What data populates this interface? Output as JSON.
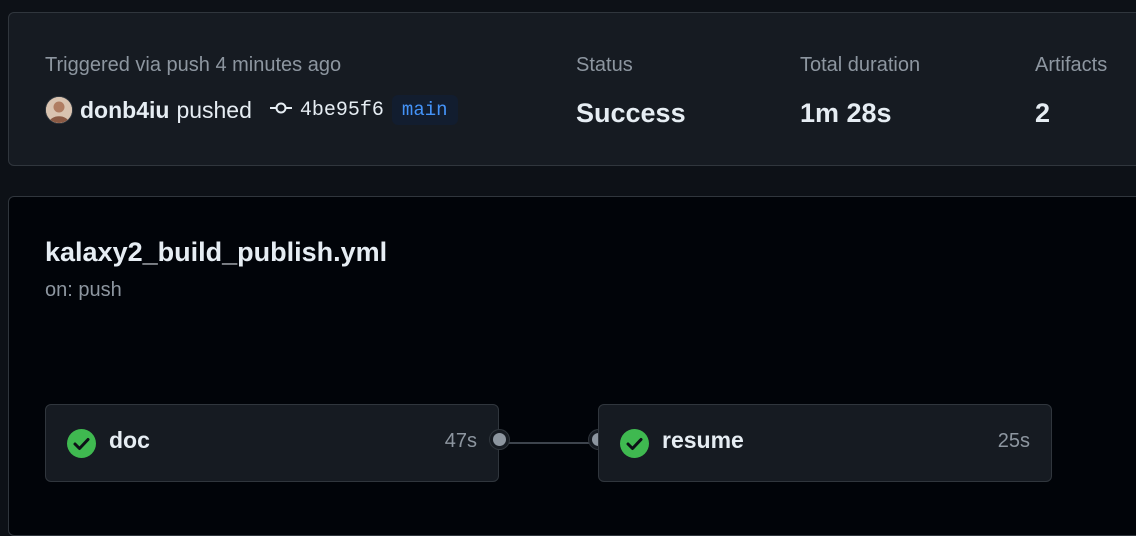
{
  "summary": {
    "trigger_text": "Triggered via push 4 minutes ago",
    "user": "donb4iu",
    "action": "pushed",
    "commit_sha": "4be95f6",
    "branch": "main",
    "status_label": "Status",
    "status_value": "Success",
    "duration_label": "Total duration",
    "duration_value": "1m 28s",
    "artifacts_label": "Artifacts",
    "artifacts_value": "2"
  },
  "workflow": {
    "name": "kalaxy2_build_publish.yml",
    "trigger": "on: push",
    "jobs": [
      {
        "name": "doc",
        "duration": "47s",
        "status": "success",
        "icon": "check-circle-icon"
      },
      {
        "name": "resume",
        "duration": "25s",
        "status": "success",
        "icon": "check-circle-icon"
      }
    ]
  },
  "colors": {
    "success": "#3fb950",
    "link": "#4493f8",
    "muted": "#8d96a0",
    "background": "#0d1117"
  }
}
